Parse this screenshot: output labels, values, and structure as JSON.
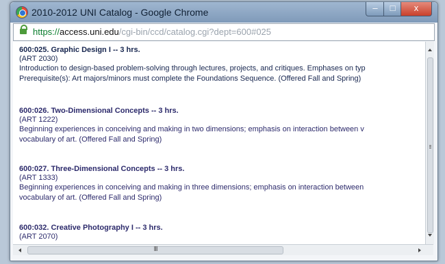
{
  "window": {
    "title": "2010-2012 UNI Catalog - Google Chrome",
    "buttons": {
      "minimize": "–",
      "maximize": "□",
      "close": "x"
    }
  },
  "address": {
    "scheme": "https://",
    "host": "access.uni.edu",
    "path": "/cgi-bin/ccd/catalog.cgi?dept=600#025"
  },
  "courses": [
    {
      "title": "600:025. Graphic Design I -- 3 hrs.",
      "code": "(ART 2030)",
      "desc1": "Introduction to design-based problem-solving through lectures, projects, and critiques. Emphases on typ",
      "desc2": "Prerequisite(s): Art majors/minors must complete the Foundations Sequence. (Offered Fall and Spring)"
    },
    {
      "title": "600:026. Two-Dimensional Concepts -- 3 hrs.",
      "code": "(ART 1222)",
      "desc1": "Beginning experiences in conceiving and making in two dimensions; emphasis on interaction between v",
      "desc2": "vocabulary of art. (Offered Fall and Spring)"
    },
    {
      "title": "600:027. Three-Dimensional Concepts -- 3 hrs.",
      "code": "(ART 1333)",
      "desc1": "Beginning experiences in conceiving and making in three dimensions; emphasis on interaction between",
      "desc2": "vocabulary of art. (Offered Fall and Spring)"
    },
    {
      "title": "600:032. Creative Photography I -- 3 hrs.",
      "code": "(ART 2070)"
    }
  ],
  "scrollbar": {
    "grip": "III"
  }
}
